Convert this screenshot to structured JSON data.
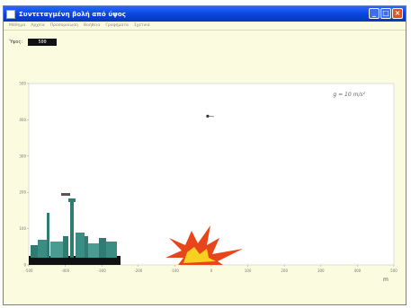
{
  "window": {
    "title": "Συντεταγμένη βολή από ύψος",
    "buttons": {
      "minimize": "_",
      "maximize": "□",
      "close": "×"
    }
  },
  "menu": {
    "items": [
      "Μάθημα",
      "Αρχεία",
      "Προσομοίωση",
      "Βοήθεια",
      "Γραφήματα",
      "Σχετικά"
    ]
  },
  "controls": {
    "height_label": "Ύψος:",
    "height_value": "500"
  },
  "plot": {
    "formula_text": "g = 10 m/s²",
    "x_unit": "m",
    "x_ticks": [
      "-500",
      "-400",
      "-300",
      "-200",
      "-100",
      "0",
      "100",
      "200",
      "300",
      "400",
      "500"
    ],
    "y_ticks": [
      "0",
      "100",
      "200",
      "300",
      "400",
      "500"
    ],
    "x_range": [
      -500,
      500
    ],
    "y_range": [
      0,
      500
    ],
    "projectile": {
      "x": -10,
      "y": 410
    }
  },
  "colors": {
    "title_bar": "#0a46e0",
    "window_bg": "#fbfbdf",
    "plot_bg": "#ffffff",
    "explosion_outer": "#e8461a",
    "explosion_inner": "#f6d21e",
    "city": "#2f7c73"
  },
  "icons": {
    "app": "window-app-icon",
    "explosion": "explosion-icon",
    "city": "city-skyline-icon",
    "projectile": "projectile-icon"
  }
}
